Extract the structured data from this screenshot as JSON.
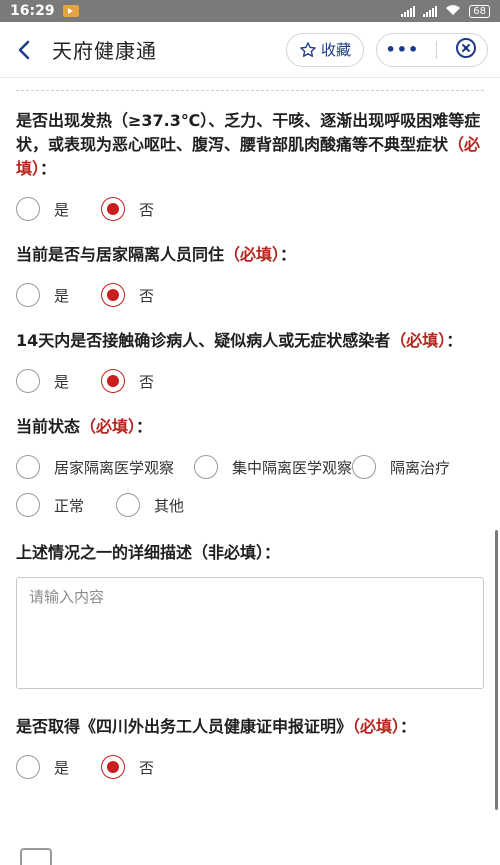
{
  "status": {
    "time": "16:29",
    "battery": "68"
  },
  "header": {
    "title": "天府健康通",
    "favorite_label": "收藏"
  },
  "q1": {
    "text": "是否出现发热（≥37.3℃）、乏力、干咳、逐渐出现呼吸困难等症状，或表现为恶心呕吐、腹泻、腰背部肌肉酸痛等不典型症状",
    "required": "（必填）",
    "suffix": "：",
    "options": [
      "是",
      "否"
    ],
    "selected": "否"
  },
  "q2": {
    "text": "当前是否与居家隔离人员同住",
    "required": "（必填）",
    "suffix": "：",
    "options": [
      "是",
      "否"
    ],
    "selected": "否"
  },
  "q3": {
    "text": "14天内是否接触确诊病人、疑似病人或无症状感染者",
    "required": "（必填）",
    "suffix": "：",
    "options": [
      "是",
      "否"
    ],
    "selected": "否"
  },
  "q4": {
    "text": "当前状态",
    "required": "（必填）",
    "suffix": "：",
    "options": [
      "居家隔离医学观察",
      "集中隔离医学观察",
      "隔离治疗",
      "正常",
      "其他"
    ]
  },
  "q5": {
    "text": "上述情况之一的详细描述（非必填）：",
    "placeholder": "请输入内容"
  },
  "q6": {
    "text": "是否取得《四川外出务工人员健康证申报证明》",
    "required": "（必填）",
    "suffix": "：",
    "options": [
      "是",
      "否"
    ],
    "selected": "否"
  }
}
